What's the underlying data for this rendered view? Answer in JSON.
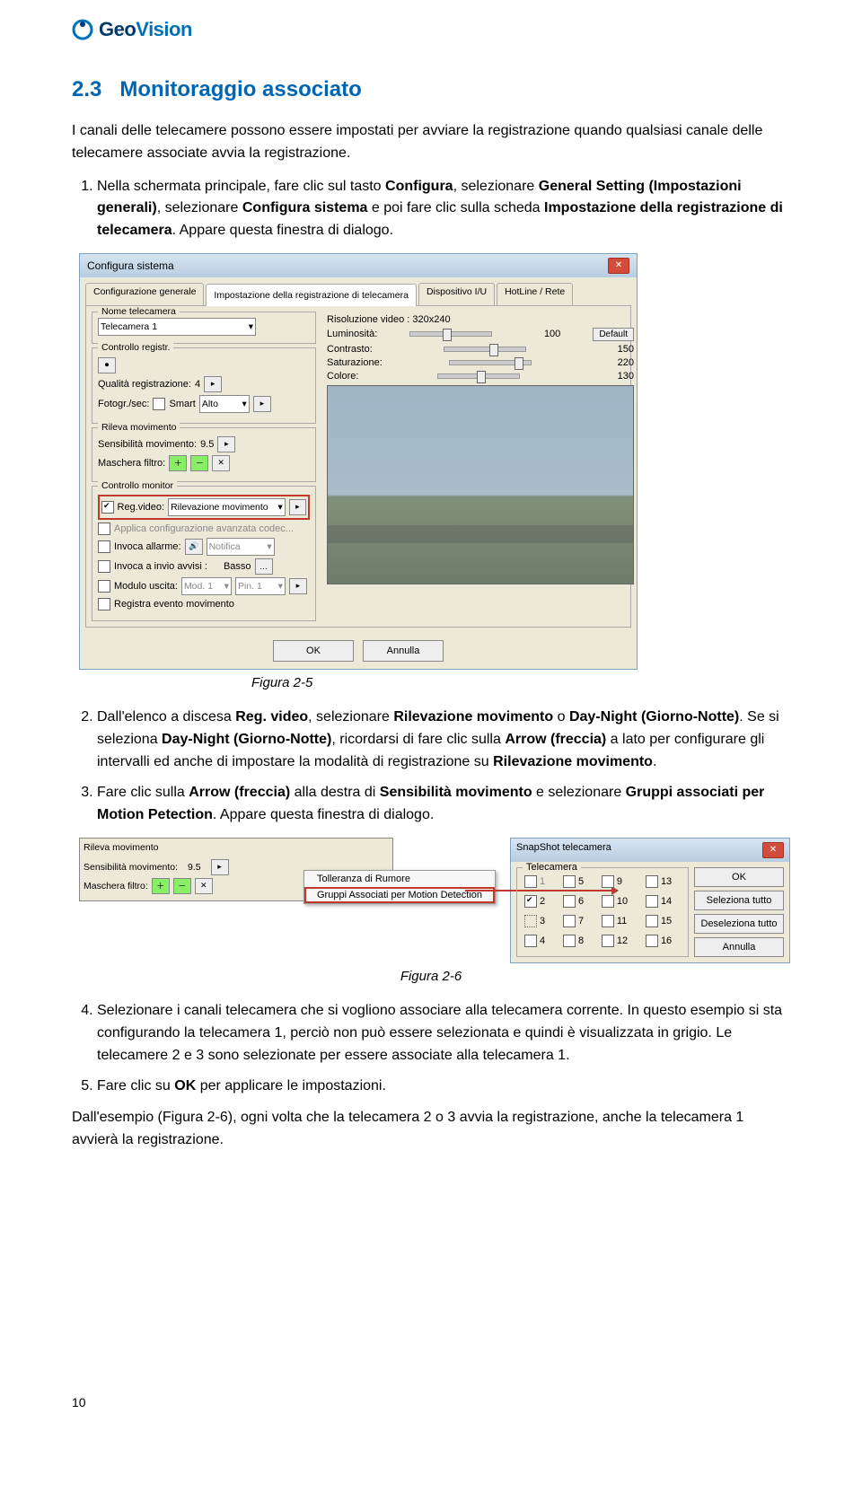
{
  "logo": {
    "brand1": "Geo",
    "brand2": "Vision"
  },
  "section": {
    "number": "2.3",
    "title": "Monitoraggio associato"
  },
  "intro": "I canali delle telecamere possono essere impostati per avviare la registrazione quando qualsiasi canale delle telecamere associate avvia la registrazione.",
  "step1_a": "Nella schermata principale, fare clic sul tasto ",
  "step1_b": "Configura",
  "step1_c": ", selezionare ",
  "step1_d": "General Setting (Impostazioni generali)",
  "step1_e": ", selezionare ",
  "step1_f": "Configura sistema",
  "step1_g": " e poi fare clic sulla scheda ",
  "step1_h": "Impostazione della registrazione di telecamera",
  "step1_i": ". Appare questa finestra di dialogo.",
  "fig5_caption": "Figura 2-5",
  "step2_a": "Dall'elenco a discesa ",
  "step2_b": "Reg. video",
  "step2_c": ", selezionare ",
  "step2_d": "Rilevazione movimento",
  "step2_e": " o ",
  "step2_f": "Day-Night (Giorno-Notte)",
  "step2_g": ". Se si seleziona ",
  "step2_h": "Day-Night (Giorno-Notte)",
  "step2_i": ", ricordarsi di fare clic sulla ",
  "step2_j": "Arrow (freccia)",
  "step2_k": " a lato per configurare gli intervalli ed anche di impostare la modalità di registrazione su ",
  "step2_l": "Rilevazione movimento",
  "step2_m": ".",
  "step3_a": "Fare clic sulla ",
  "step3_b": "Arrow (freccia)",
  "step3_c": " alla destra di ",
  "step3_d": "Sensibilità movimento",
  "step3_e": " e selezionare ",
  "step3_f": "Gruppi associati per Motion Petection",
  "step3_g": ". Appare questa finestra di dialogo.",
  "fig6_caption": "Figura 2-6",
  "step4": "Selezionare i canali telecamera che si vogliono associare alla telecamera corrente. In questo esempio si sta configurando la telecamera 1, perciò non può essere selezionata e quindi è visualizzata in grigio. Le telecamere 2 e 3 sono selezionate per essere associate alla telecamera 1.",
  "step5_a": "Fare clic su ",
  "step5_b": "OK",
  "step5_c": " per applicare le impostazioni.",
  "outro": "Dall'esempio (Figura 2-6), ogni volta che la telecamera 2 o 3 avvia la registrazione, anche la telecamera 1 avvierà la registrazione.",
  "page_number": "10",
  "win": {
    "title": "Configura sistema",
    "tabs": [
      "Configurazione generale",
      "Impostazione della registrazione di telecamera",
      "Dispositivo I/U",
      "HotLine / Rete"
    ],
    "groups": {
      "nome": "Nome telecamera",
      "camera_sel": "Telecamera 1",
      "controllo": "Controllo registr.",
      "qualita": "Qualità registrazione:",
      "qualita_val": "4",
      "fotogr": "Fotogr./sec:",
      "smart": "Smart",
      "alto": "Alto",
      "rileva": "Rileva movimento",
      "sens": "Sensibilità movimento:",
      "sens_val": "9.5",
      "maschera": "Maschera filtro:",
      "monitor": "Controllo monitor",
      "regvideo_lbl": "Reg.video:",
      "regvideo_val": "Rilevazione movimento",
      "applica": "Applica configurazione avanzata codec...",
      "invoca_allarme": "Invoca allarme:",
      "notifica": "Notifica",
      "invoca_avvisi": "Invoca a invio avvisi :",
      "basso": "Basso",
      "modulo": "Modulo uscita:",
      "mod1": "Mod. 1",
      "pin1": "Pin. 1",
      "regevt": "Registra evento movimento",
      "risoluzione": "Risoluzione video : 320x240",
      "luminosita": "Luminosità:",
      "lum_val": "100",
      "contrasto": "Contrasto:",
      "con_val": "150",
      "saturazione": "Saturazione:",
      "sat_val": "220",
      "colore": "Colore:",
      "col_val": "130",
      "default": "Default",
      "ok": "OK",
      "annulla": "Annulla"
    }
  },
  "ctx": {
    "item1": "Tolleranza di Rumore",
    "item2": "Gruppi Associati per Motion Detection"
  },
  "snap": {
    "title": "SnapShot telecamera",
    "group": "Telecamera",
    "nums": [
      "1",
      "5",
      "9",
      "13",
      "2",
      "6",
      "10",
      "14",
      "3",
      "7",
      "11",
      "15",
      "4",
      "8",
      "12",
      "16"
    ],
    "ok": "OK",
    "seltutto": "Seleziona tutto",
    "desel": "Deseleziona tutto",
    "annulla": "Annulla"
  },
  "panelA": {
    "rileva": "Rileva movimento",
    "sens": "Sensibilità movimento:",
    "sens_val": "9.5",
    "maschera": "Maschera filtro:"
  }
}
